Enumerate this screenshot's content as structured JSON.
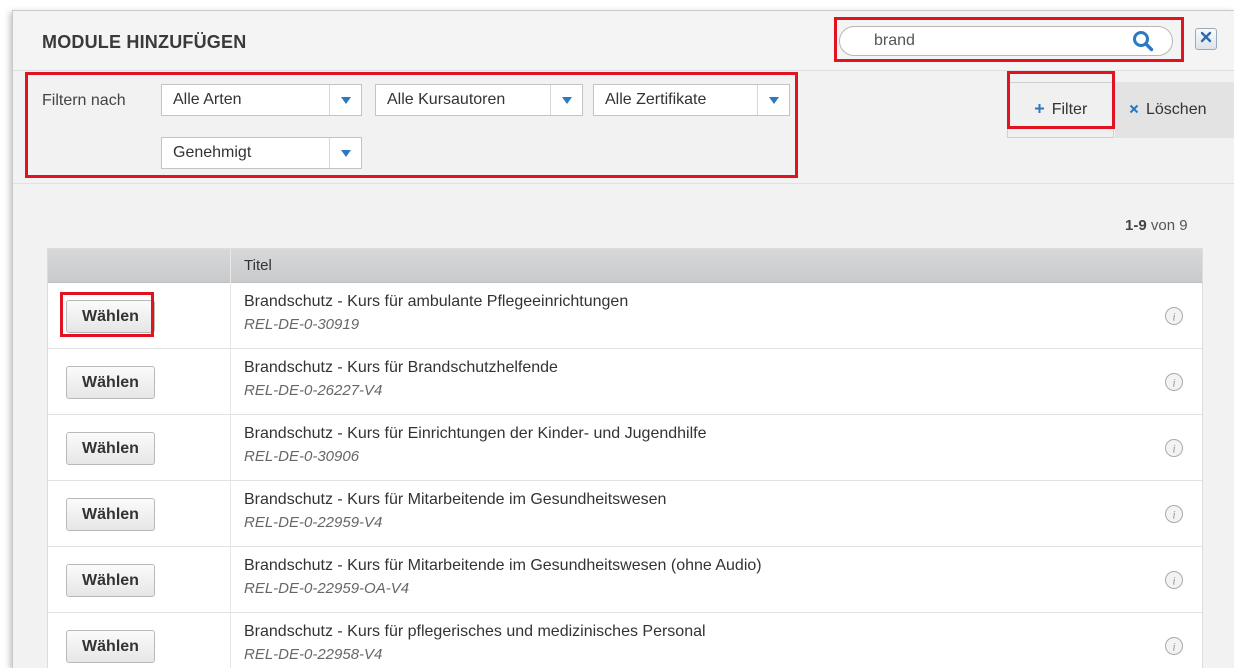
{
  "dialog": {
    "title": "MODULE HINZUFÜGEN",
    "search": {
      "value": "brand",
      "placeholder": ""
    }
  },
  "filters": {
    "label": "Filtern nach",
    "selects": [
      {
        "value": "Alle Arten"
      },
      {
        "value": "Alle Kursautoren"
      },
      {
        "value": "Alle Zertifikate"
      },
      {
        "value": "Genehmigt"
      }
    ],
    "filter_button": "Filter",
    "clear_button": "Löschen"
  },
  "pager": {
    "range": "1-9",
    "suffix": " von 9"
  },
  "table": {
    "header": {
      "action": "",
      "title": "Titel"
    },
    "choose_label": "Wählen",
    "rows": [
      {
        "title": "Brandschutz - Kurs für ambulante Pflegeeinrichtungen",
        "code": "REL-DE-0-30919"
      },
      {
        "title": "Brandschutz - Kurs für Brandschutzhelfende",
        "code": "REL-DE-0-26227-V4"
      },
      {
        "title": "Brandschutz - Kurs für Einrichtungen der Kinder- und Jugendhilfe",
        "code": "REL-DE-0-30906"
      },
      {
        "title": "Brandschutz - Kurs für Mitarbeitende im Gesundheitswesen",
        "code": "REL-DE-0-22959-V4"
      },
      {
        "title": "Brandschutz - Kurs für Mitarbeitende im Gesundheitswesen (ohne Audio)",
        "code": "REL-DE-0-22959-OA-V4"
      },
      {
        "title": "Brandschutz - Kurs für pflegerisches und medizinisches Personal",
        "code": "REL-DE-0-22958-V4"
      }
    ]
  },
  "colors": {
    "accent": "#2b78c5",
    "highlight": "#e0141e"
  },
  "icons": {
    "search": "search-icon",
    "close": "close-icon",
    "info": "info-icon",
    "plus": "plus-icon",
    "clear": "x-icon",
    "dropdown": "chevron-down-icon"
  }
}
